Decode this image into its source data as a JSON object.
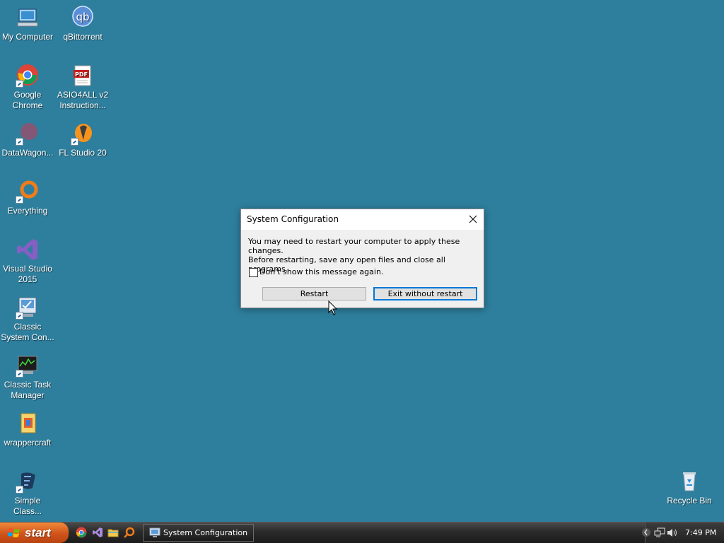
{
  "desktop": {
    "icons": [
      {
        "label": "My Computer",
        "icon": "computer-icon"
      },
      {
        "label": "qBittorrent",
        "icon": "qbittorrent-icon"
      },
      {
        "label": "Google Chrome",
        "icon": "chrome-icon"
      },
      {
        "label": "ASIO4ALL v2 Instruction...",
        "icon": "pdf-icon"
      },
      {
        "label": "DataWagon...",
        "icon": "datawagon-icon"
      },
      {
        "label": "FL Studio 20",
        "icon": "fl-studio-icon"
      },
      {
        "label": "Everything",
        "icon": "everything-search-icon"
      },
      {
        "label": "Visual Studio 2015",
        "icon": "visual-studio-icon"
      },
      {
        "label": "Classic System Con...",
        "icon": "system-config-icon"
      },
      {
        "label": "Classic Task Manager",
        "icon": "task-manager-icon"
      },
      {
        "label": "wrappercraft",
        "icon": "wrappercraft-icon"
      },
      {
        "label": "Simple Class...",
        "icon": "simple-class-icon"
      },
      {
        "label": "Recycle Bin",
        "icon": "recycle-bin-icon"
      }
    ]
  },
  "dialog": {
    "title": "System Configuration",
    "message_line1": "You may need to restart your computer to apply these changes.",
    "message_line2": "Before restarting, save any open files and close all programs.",
    "checkbox_label": "Don't show this message again.",
    "checkbox_checked": false,
    "restart_label": "Restart",
    "exit_label": "Exit without restart"
  },
  "taskbar": {
    "start_label": "start",
    "task_label": "System Configuration",
    "clock": "7:49 PM"
  },
  "colors": {
    "desktop_bg": "#2e7f9d",
    "start_orange": "#d0541b",
    "focus_blue": "#0078d7"
  }
}
